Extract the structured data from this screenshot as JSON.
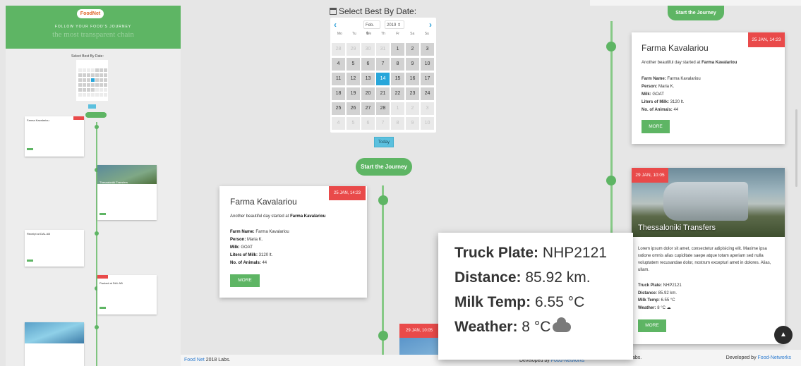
{
  "overview": {
    "logo": "FoodNet",
    "tagline": "FOLLOW YOUR FOOD'S JOURNEY",
    "headline": "the most transparent chain",
    "calendar_title": "Select Best By Date:",
    "cards": [
      {
        "title": "Farma Kavalariou"
      },
      {
        "title": "Thessaloniki Transfers"
      },
      {
        "title": "Receipt at DAL AB"
      },
      {
        "title": "Packed at DAL AB"
      },
      {
        "title": ""
      }
    ]
  },
  "calendar": {
    "title": "Select Best By Date:",
    "prev": "‹",
    "next": "›",
    "month": "Feb.",
    "year": "2019",
    "weekdays": [
      "Mo",
      "Tu",
      "We",
      "Th",
      "Fr",
      "Sa",
      "Su"
    ],
    "days": [
      [
        "28",
        "m"
      ],
      [
        "29",
        "m"
      ],
      [
        "30",
        "m"
      ],
      [
        "31",
        "m"
      ],
      [
        "1",
        ""
      ],
      [
        "2",
        ""
      ],
      [
        "3",
        ""
      ],
      [
        "4",
        ""
      ],
      [
        "5",
        ""
      ],
      [
        "6",
        ""
      ],
      [
        "7",
        ""
      ],
      [
        "8",
        ""
      ],
      [
        "9",
        ""
      ],
      [
        "10",
        ""
      ],
      [
        "11",
        ""
      ],
      [
        "12",
        ""
      ],
      [
        "13",
        ""
      ],
      [
        "14",
        "t"
      ],
      [
        "15",
        ""
      ],
      [
        "16",
        ""
      ],
      [
        "17",
        ""
      ],
      [
        "18",
        ""
      ],
      [
        "19",
        ""
      ],
      [
        "20",
        ""
      ],
      [
        "21",
        ""
      ],
      [
        "22",
        ""
      ],
      [
        "23",
        ""
      ],
      [
        "24",
        ""
      ],
      [
        "25",
        ""
      ],
      [
        "26",
        ""
      ],
      [
        "27",
        ""
      ],
      [
        "28",
        ""
      ],
      [
        "1",
        "m"
      ],
      [
        "2",
        "m"
      ],
      [
        "3",
        "m"
      ],
      [
        "4",
        "m"
      ],
      [
        "5",
        "m"
      ],
      [
        "6",
        "m"
      ],
      [
        "7",
        "m"
      ],
      [
        "8",
        "m"
      ],
      [
        "9",
        "m"
      ],
      [
        "10",
        "m"
      ]
    ],
    "today_label": "Today"
  },
  "journey_button": "Start the Journey",
  "farm_card": {
    "title": "Farma Kavalariou",
    "date": "25 JAN, 14:23",
    "intro": "Another beautiful day started at",
    "intro_bold": "Farma Kavalariou",
    "fields": [
      {
        "label": "Farm Name:",
        "value": "Farma Kavalariou"
      },
      {
        "label": "Person:",
        "value": "Maria K."
      },
      {
        "label": "Milk:",
        "value": "GOAT"
      },
      {
        "label": "Liters of Milk:",
        "value": "3120 lt."
      },
      {
        "label": "No. of Animals:",
        "value": "44"
      }
    ],
    "more": "MORE"
  },
  "peek_card": {
    "date": "29 JAN, 10:05"
  },
  "transfer_card": {
    "date": "29 JAN, 10:05",
    "title": "Thessaloniki Transfers",
    "lorem": "Lorem ipsum dolor sit amet, consectetur adipisicing elit. Maxime ipsa ratione omnis alias cupiditate saepe atque totam aperiam sed nulla voluptatem recusandae dolor, nostrum excepturi amet in dolores. Alias, ullam.",
    "fields": [
      {
        "label": "Truck Plate:",
        "value": "NHP2121"
      },
      {
        "label": "Distance:",
        "value": "85.92 km."
      },
      {
        "label": "Milk Temp:",
        "value": "6.55 °C"
      },
      {
        "label": "Weather:",
        "value": "8 °C"
      }
    ],
    "more": "MORE"
  },
  "zoom": {
    "rows": [
      {
        "label": "Truck Plate:",
        "value": "NHP2121"
      },
      {
        "label": "Distance:",
        "value": "85.92 km."
      },
      {
        "label": "Milk Temp:",
        "value": "6.55 °C"
      },
      {
        "label": "Weather:",
        "value": "8 °C"
      }
    ],
    "weather_icon": "cloud-icon"
  },
  "footer": {
    "brand": "Food Net",
    "brand_suffix": " 2018 Labs.",
    "right_prefix": "Developed by ",
    "right_link": "Food-Networks",
    "right_col_left": "abs."
  },
  "colors": {
    "accent": "#5eb564",
    "badge": "#e94a4a",
    "today": "#27a6da"
  }
}
